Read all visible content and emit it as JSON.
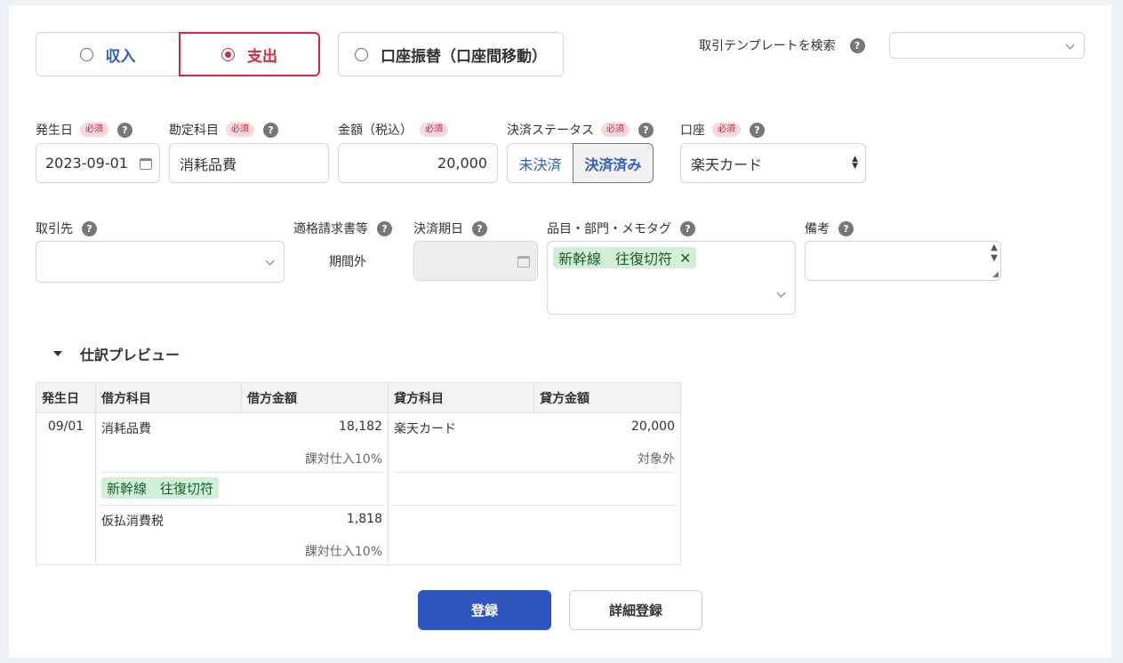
{
  "transaction_type": {
    "income_label": "収入",
    "expense_label": "支出",
    "transfer_label": "口座振替（口座間移動）",
    "selected": "expense"
  },
  "template_search": {
    "label": "取引テンプレートを検索",
    "value": ""
  },
  "required_badge": "必須",
  "help_glyph": "?",
  "fields": {
    "date": {
      "label": "発生日",
      "value": "2023-09-01"
    },
    "account_item": {
      "label": "勘定科目",
      "value": "消耗品費"
    },
    "amount": {
      "label": "金額（税込）",
      "value": "20,000"
    },
    "payment_status": {
      "label": "決済ステータス",
      "unpaid_label": "未決済",
      "paid_label": "決済済み",
      "selected": "paid"
    },
    "wallet": {
      "label": "口座",
      "value": "楽天カード"
    },
    "partner": {
      "label": "取引先",
      "value": ""
    },
    "invoice": {
      "label": "適格請求書等",
      "value": "期間外"
    },
    "due_date": {
      "label": "決済期日",
      "value": ""
    },
    "tags": {
      "label": "品目・部門・メモタグ",
      "items": [
        "新幹線　往復切符"
      ],
      "remove_glyph": "✕"
    },
    "memo": {
      "label": "備考",
      "value": ""
    }
  },
  "preview": {
    "title": "仕訳プレビュー",
    "headers": [
      "発生日",
      "借方科目",
      "借方金額",
      "貸方科目",
      "貸方金額"
    ],
    "date": "09/01",
    "rows": [
      {
        "debit_item": "消耗品費",
        "debit_amount": "18,182",
        "debit_tax": "課対仕入10%",
        "tag": "新幹線　往復切符",
        "credit_item": "楽天カード",
        "credit_amount": "20,000",
        "credit_tax": "対象外"
      },
      {
        "debit_item": "仮払消費税",
        "debit_amount": "1,818",
        "debit_tax": "課対仕入10%"
      }
    ]
  },
  "actions": {
    "register_label": "登録",
    "detail_register_label": "詳細登録"
  },
  "colors": {
    "accent_blue": "#2f55be",
    "expense_red": "#d1293d",
    "tag_green": "#d2f0d8"
  }
}
